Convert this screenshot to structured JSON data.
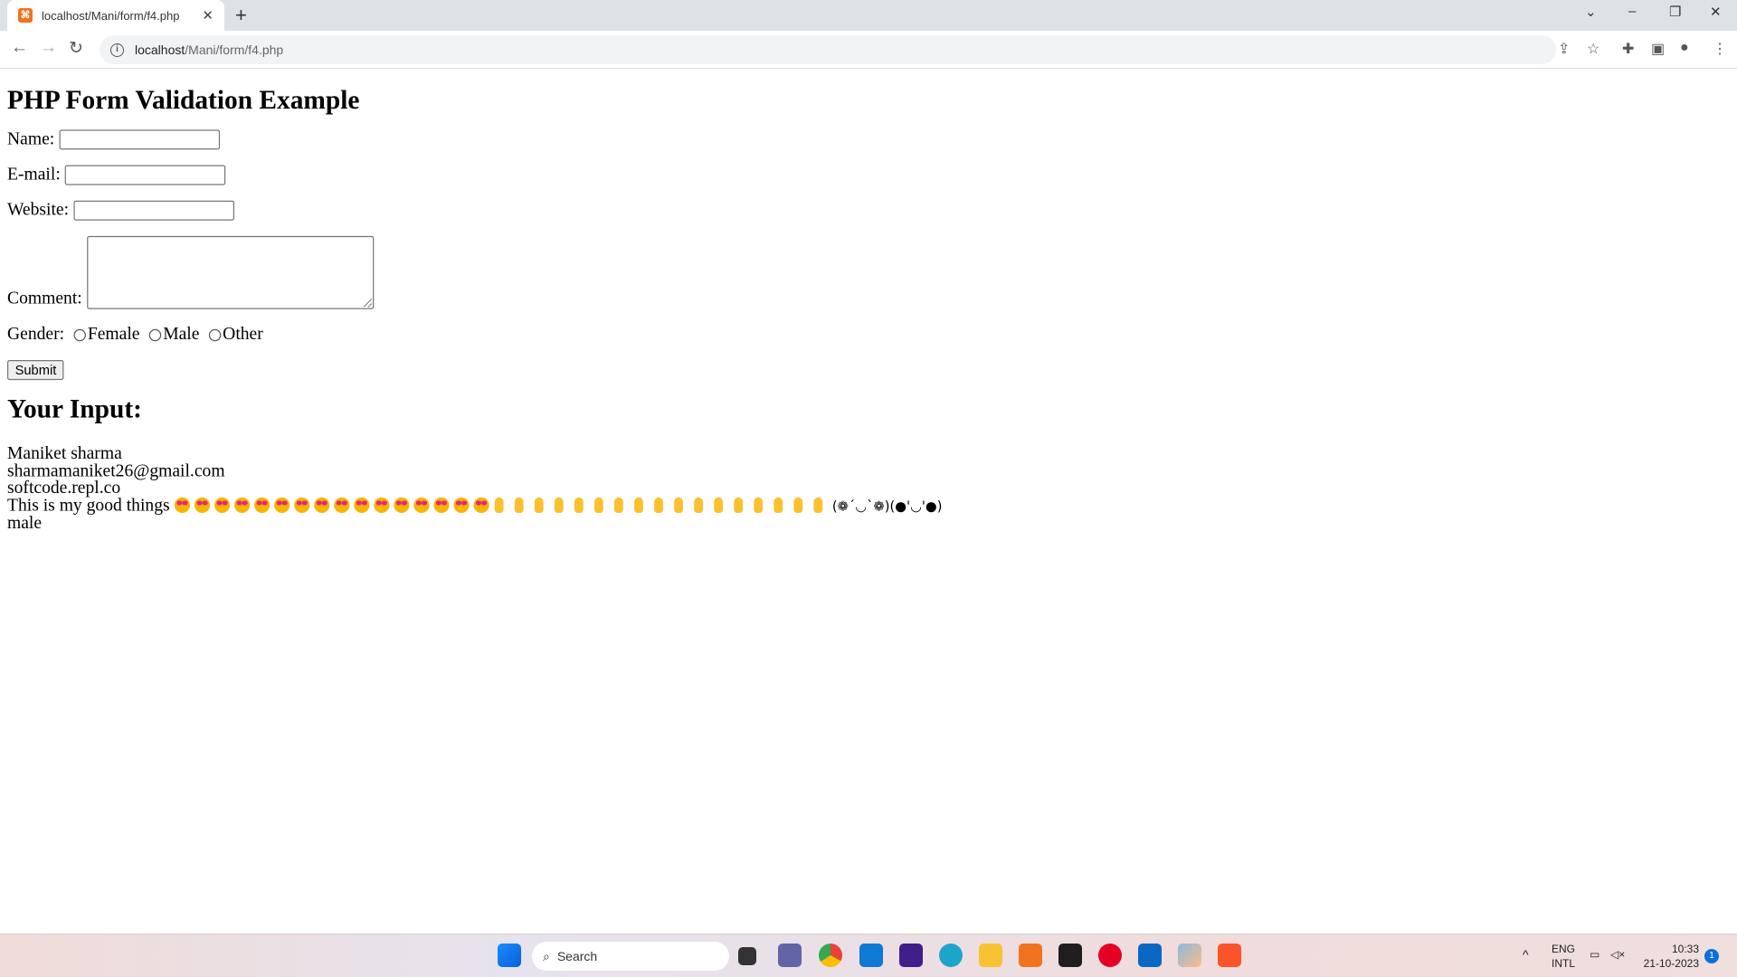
{
  "browser": {
    "tab_title": "localhost/Mani/form/f4.php",
    "url_host": "localhost",
    "url_path": "/Mani/form/f4.php"
  },
  "page": {
    "title": "PHP Form Validation Example",
    "fields": {
      "name_label": "Name:",
      "email_label": "E-mail:",
      "website_label": "Website:",
      "comment_label": "Comment:",
      "gender_label": "Gender:"
    },
    "gender_options": [
      "Female",
      "Male",
      "Other"
    ],
    "submit_label": "Submit",
    "output_heading": "Your Input:",
    "output": {
      "name": "Maniket sharma",
      "email": "sharmamaniket26@gmail.com",
      "website": "softcode.repl.co",
      "comment_text": "This is my good things",
      "emojis": [
        {
          "type": "heart-eyes",
          "count": 16
        },
        {
          "type": "ok-hand",
          "count": 17
        }
      ],
      "kaomoji": "(❁´◡`❁)(●'◡'●)",
      "gender": "male"
    }
  },
  "taskbar": {
    "search_placeholder": "Search",
    "lang": "ENG",
    "layout": "INTL",
    "time": "10:33",
    "date": "21-10-2023",
    "notifications": "1"
  }
}
